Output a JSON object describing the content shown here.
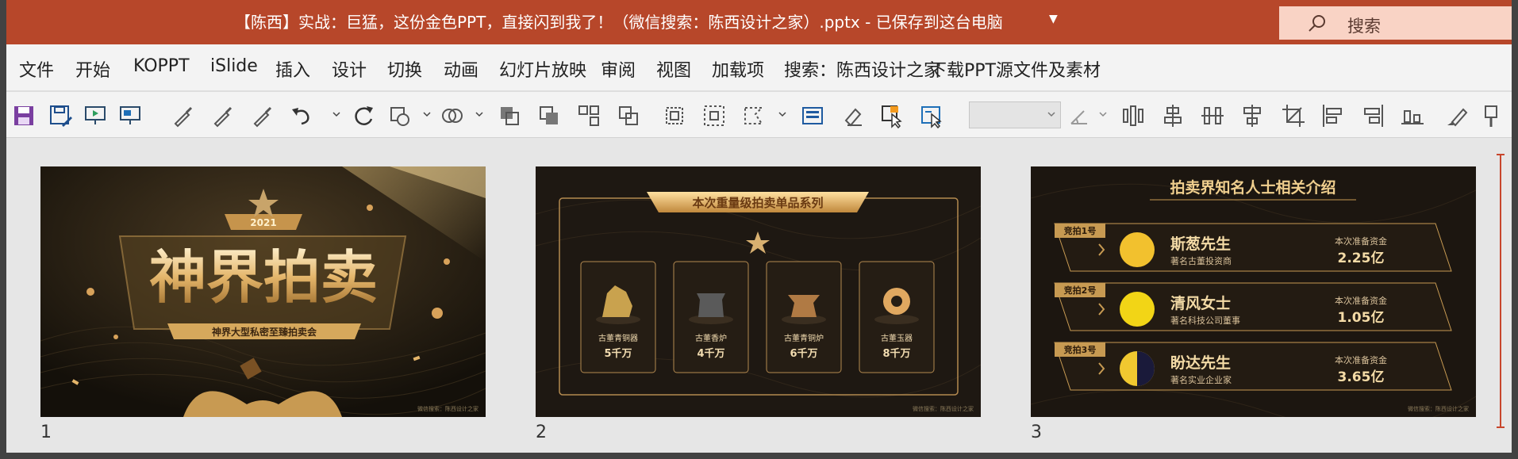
{
  "titlebar": {
    "title": "【陈西】实战：巨猛，这份金色PPT，直接闪到我了！（微信搜索：陈西设计之家）.pptx  -  已保存到这台电脑",
    "search_label": "搜索"
  },
  "menu": {
    "items": [
      "文件",
      "开始",
      "KOPPT",
      "iSlide",
      "插入",
      "设计",
      "切换",
      "动画",
      "幻灯片放映",
      "审阅",
      "视图",
      "加载项",
      "搜索：陈西设计之家",
      "下载PPT源文件及素材"
    ]
  },
  "colors": {
    "titlebar": "#b7472a",
    "gold": "#e3b86a",
    "slide_bg": "#1c1610"
  },
  "slides": [
    {
      "number": "1",
      "year": "2021",
      "title": "神界拍卖",
      "subtitle": "神界大型私密至臻拍卖会",
      "watermark": "微信搜索：陈西设计之家"
    },
    {
      "number": "2",
      "title": "本次重量级拍卖单品系列",
      "items": [
        {
          "name": "古董青铜器",
          "price": "5千万"
        },
        {
          "name": "古董香炉",
          "price": "4千万"
        },
        {
          "name": "古董青铜炉",
          "price": "6千万"
        },
        {
          "name": "古董玉器",
          "price": "8千万"
        }
      ],
      "watermark": "微信搜索：陈西设计之家"
    },
    {
      "number": "3",
      "title": "拍卖界知名人士相关介绍",
      "people": [
        {
          "tag": "竞拍1号",
          "name": "斯葱先生",
          "desc": "著名古董投资商",
          "fund_label": "本次准备资金",
          "fund": "2.25亿"
        },
        {
          "tag": "竞拍2号",
          "name": "清风女士",
          "desc": "著名科技公司董事",
          "fund_label": "本次准备资金",
          "fund": "1.05亿"
        },
        {
          "tag": "竞拍3号",
          "name": "盼达先生",
          "desc": "著名实业企业家",
          "fund_label": "本次准备资金",
          "fund": "3.65亿"
        }
      ],
      "watermark": "微信搜索：陈西设计之家"
    }
  ]
}
